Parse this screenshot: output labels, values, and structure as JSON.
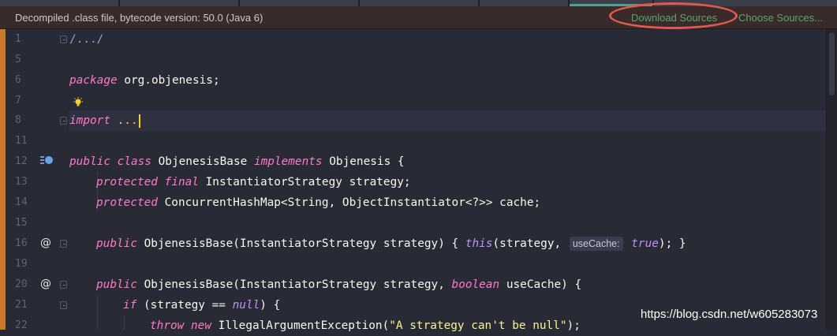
{
  "banner": {
    "text": "Decompiled .class file, bytecode version: 50.0 (Java 6)",
    "download_label": "Download Sources",
    "choose_label": "Choose Sources..."
  },
  "code": {
    "line_numbers": [
      "1",
      "5",
      "6",
      "7",
      "8",
      "11",
      "12",
      "13",
      "14",
      "15",
      "16",
      "19",
      "20",
      "21",
      "22"
    ],
    "l1": "/.../",
    "l6_kw": "package",
    "l6_rest": " org.objenesis;",
    "l8_kw": "import",
    "l8_rest": " ...",
    "l12_public": "public",
    "l12_class": "class",
    "l12_name": " ObjenesisBase ",
    "l12_impl": "implements",
    "l12_rest": " Objenesis {",
    "l13_prot": "protected",
    "l13_final": "final",
    "l13_rest": " InstantiatorStrategy strategy;",
    "l14_prot": "protected",
    "l14_rest": " ConcurrentHashMap<String, ObjectInstantiator<?>> cache;",
    "l16_public": "public",
    "l16_a": " ObjenesisBase(InstantiatorStrategy strategy) { ",
    "l16_this": "this",
    "l16_b": "(strategy, ",
    "l16_hint": "useCache:",
    "l16_true": "true",
    "l16_c": "); }",
    "l20_public": "public",
    "l20_a": " ObjenesisBase(InstantiatorStrategy strategy, ",
    "l20_bool": "boolean",
    "l20_b": " useCache) {",
    "l21_if": "if",
    "l21_a": " (strategy == ",
    "l21_null": "null",
    "l21_b": ") {",
    "l22_throw": "throw",
    "l22_new": "new",
    "l22_a": " IllegalArgumentException(",
    "l22_str": "\"A strategy can't be null\"",
    "l22_b": ");"
  },
  "watermark": "https://blog.csdn.net/w605283073",
  "colors": {
    "background": "#282a36",
    "banner_bg": "#3a2b2b",
    "link": "#5aa66a",
    "annotation": "#e0584e",
    "keyword": "#ff79c6",
    "string": "#f1fa8c"
  },
  "icons": [
    "lightbulb-icon",
    "implementation-gutter-icon",
    "annotation-at-icon",
    "fold-marker-icon"
  ]
}
